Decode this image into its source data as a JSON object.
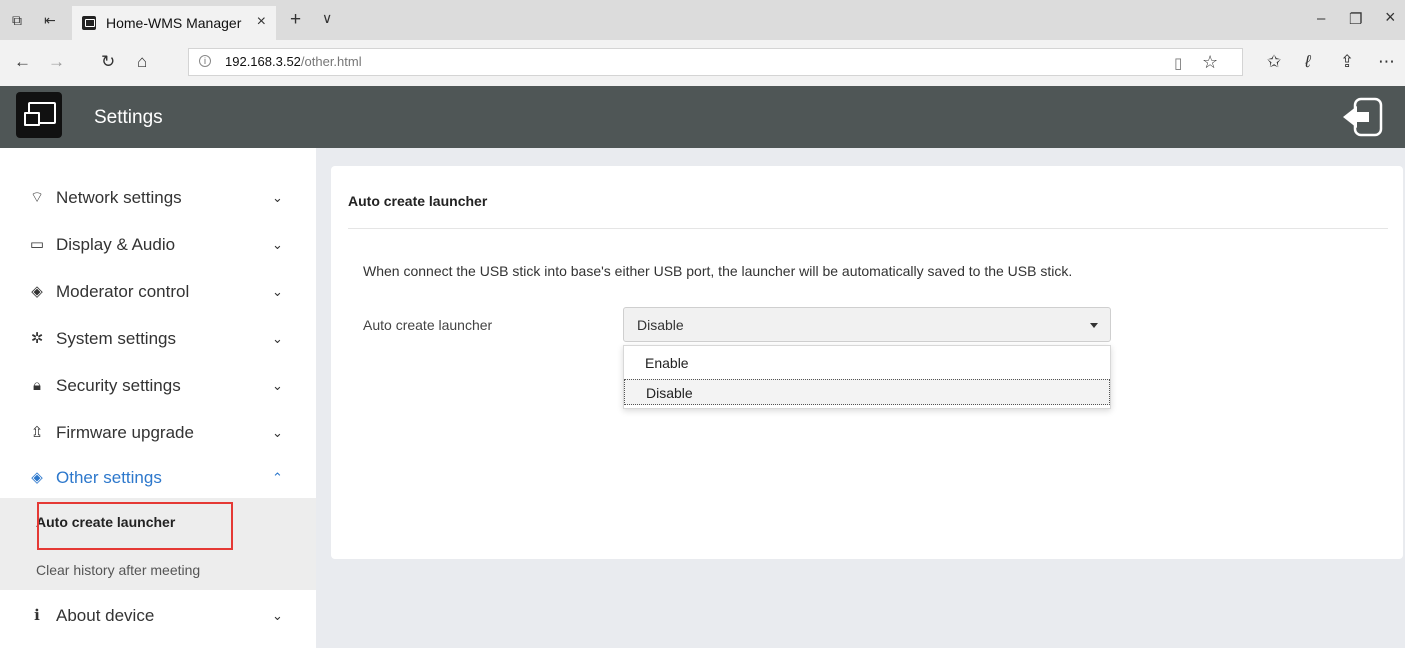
{
  "browser": {
    "tab_title": "Home-WMS Manager",
    "tab_close": "×",
    "new_tab": "+",
    "url_host": "192.168.3.52",
    "url_path": "/other.html"
  },
  "app": {
    "title": "Settings"
  },
  "sidebar": {
    "items": [
      {
        "label": "Network settings",
        "icon": "wifi-icon"
      },
      {
        "label": "Display & Audio",
        "icon": "monitor-icon"
      },
      {
        "label": "Moderator control",
        "icon": "diamond-icon"
      },
      {
        "label": "System settings",
        "icon": "gear-icon"
      },
      {
        "label": "Security settings",
        "icon": "lock-icon"
      },
      {
        "label": "Firmware upgrade",
        "icon": "upload-icon"
      },
      {
        "label": "Other settings",
        "icon": "diamond-icon"
      },
      {
        "label": "About device",
        "icon": "info-icon"
      }
    ],
    "sub_items": [
      "Auto create launcher",
      "Clear history after meeting"
    ]
  },
  "main": {
    "section_title": "Auto create launcher",
    "description": "When connect the USB stick into base's either USB port, the launcher will be automatically saved to the USB stick.",
    "field_label": "Auto create launcher",
    "selected_value": "Disable",
    "options": [
      "Enable",
      "Disable"
    ]
  },
  "colors": {
    "header_bg": "#4f5656",
    "accent": "#2d78cc",
    "highlight": "#e53935",
    "content_bg": "#e9ebef"
  }
}
